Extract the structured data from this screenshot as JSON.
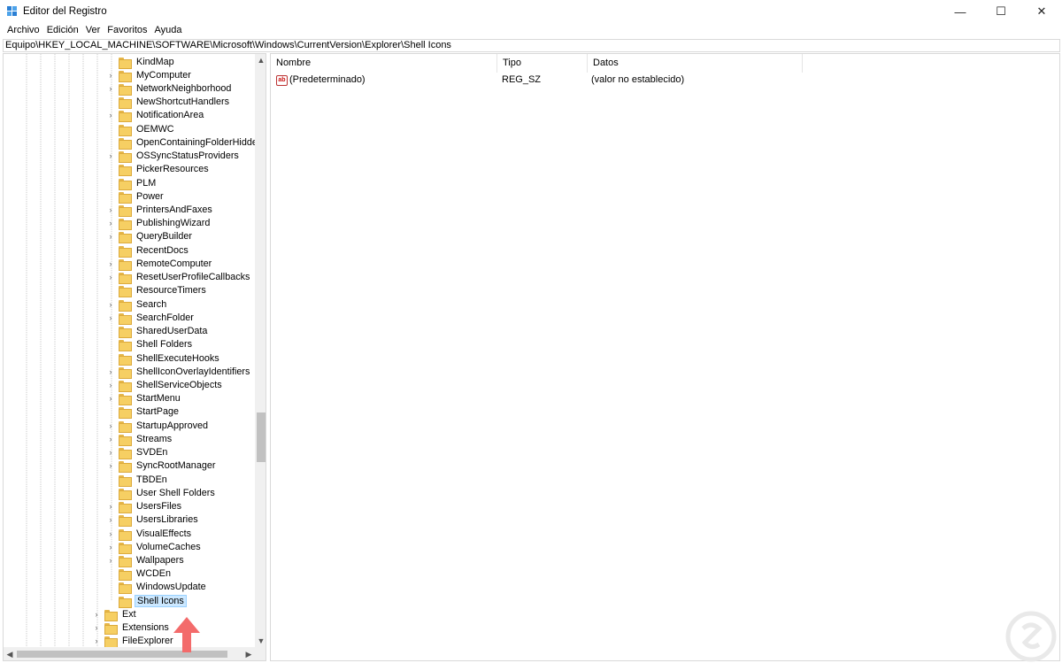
{
  "window": {
    "title": "Editor del Registro",
    "minimize_glyph": "—",
    "maximize_glyph": "☐",
    "close_glyph": "✕"
  },
  "menu": [
    "Archivo",
    "Edición",
    "Ver",
    "Favoritos",
    "Ayuda"
  ],
  "address": "Equipo\\HKEY_LOCAL_MACHINE\\SOFTWARE\\Microsoft\\Windows\\CurrentVersion\\Explorer\\Shell Icons",
  "tree": {
    "nodes": [
      {
        "label": "KindMap",
        "expandable": false,
        "level": 2
      },
      {
        "label": "MyComputer",
        "expandable": true,
        "level": 2
      },
      {
        "label": "NetworkNeighborhood",
        "expandable": true,
        "level": 2
      },
      {
        "label": "NewShortcutHandlers",
        "expandable": false,
        "level": 2
      },
      {
        "label": "NotificationArea",
        "expandable": true,
        "level": 2
      },
      {
        "label": "OEMWC",
        "expandable": false,
        "level": 2
      },
      {
        "label": "OpenContainingFolderHiddenList",
        "expandable": false,
        "level": 2
      },
      {
        "label": "OSSyncStatusProviders",
        "expandable": true,
        "level": 2
      },
      {
        "label": "PickerResources",
        "expandable": false,
        "level": 2
      },
      {
        "label": "PLM",
        "expandable": false,
        "level": 2
      },
      {
        "label": "Power",
        "expandable": false,
        "level": 2
      },
      {
        "label": "PrintersAndFaxes",
        "expandable": true,
        "level": 2
      },
      {
        "label": "PublishingWizard",
        "expandable": true,
        "level": 2
      },
      {
        "label": "QueryBuilder",
        "expandable": true,
        "level": 2
      },
      {
        "label": "RecentDocs",
        "expandable": false,
        "level": 2
      },
      {
        "label": "RemoteComputer",
        "expandable": true,
        "level": 2
      },
      {
        "label": "ResetUserProfileCallbacks",
        "expandable": true,
        "level": 2
      },
      {
        "label": "ResourceTimers",
        "expandable": false,
        "level": 2
      },
      {
        "label": "Search",
        "expandable": true,
        "level": 2
      },
      {
        "label": "SearchFolder",
        "expandable": true,
        "level": 2
      },
      {
        "label": "SharedUserData",
        "expandable": false,
        "level": 2
      },
      {
        "label": "Shell Folders",
        "expandable": false,
        "level": 2
      },
      {
        "label": "ShellExecuteHooks",
        "expandable": false,
        "level": 2
      },
      {
        "label": "ShellIconOverlayIdentifiers",
        "expandable": true,
        "level": 2
      },
      {
        "label": "ShellServiceObjects",
        "expandable": true,
        "level": 2
      },
      {
        "label": "StartMenu",
        "expandable": true,
        "level": 2
      },
      {
        "label": "StartPage",
        "expandable": false,
        "level": 2
      },
      {
        "label": "StartupApproved",
        "expandable": true,
        "level": 2
      },
      {
        "label": "Streams",
        "expandable": true,
        "level": 2
      },
      {
        "label": "SVDEn",
        "expandable": true,
        "level": 2
      },
      {
        "label": "SyncRootManager",
        "expandable": true,
        "level": 2
      },
      {
        "label": "TBDEn",
        "expandable": false,
        "level": 2
      },
      {
        "label": "User Shell Folders",
        "expandable": false,
        "level": 2
      },
      {
        "label": "UsersFiles",
        "expandable": true,
        "level": 2
      },
      {
        "label": "UsersLibraries",
        "expandable": true,
        "level": 2
      },
      {
        "label": "VisualEffects",
        "expandable": true,
        "level": 2
      },
      {
        "label": "VolumeCaches",
        "expandable": true,
        "level": 2
      },
      {
        "label": "Wallpapers",
        "expandable": true,
        "level": 2
      },
      {
        "label": "WCDEn",
        "expandable": false,
        "level": 2
      },
      {
        "label": "WindowsUpdate",
        "expandable": false,
        "level": 2
      },
      {
        "label": "Shell Icons",
        "expandable": false,
        "level": 2,
        "selected": true
      },
      {
        "label": "Ext",
        "expandable": true,
        "level": 1
      },
      {
        "label": "Extensions",
        "expandable": true,
        "level": 1
      },
      {
        "label": "FileExplorer",
        "expandable": true,
        "level": 1
      }
    ]
  },
  "list": {
    "columns": {
      "name": "Nombre",
      "type": "Tipo",
      "data": "Datos"
    },
    "rows": [
      {
        "icon": "ab",
        "name": "(Predeterminado)",
        "type": "REG_SZ",
        "data": "(valor no establecido)"
      }
    ]
  },
  "colors": {
    "selection_bg": "#cce8ff",
    "folder": "#f6cf63",
    "arrow": "#f36b6b"
  }
}
